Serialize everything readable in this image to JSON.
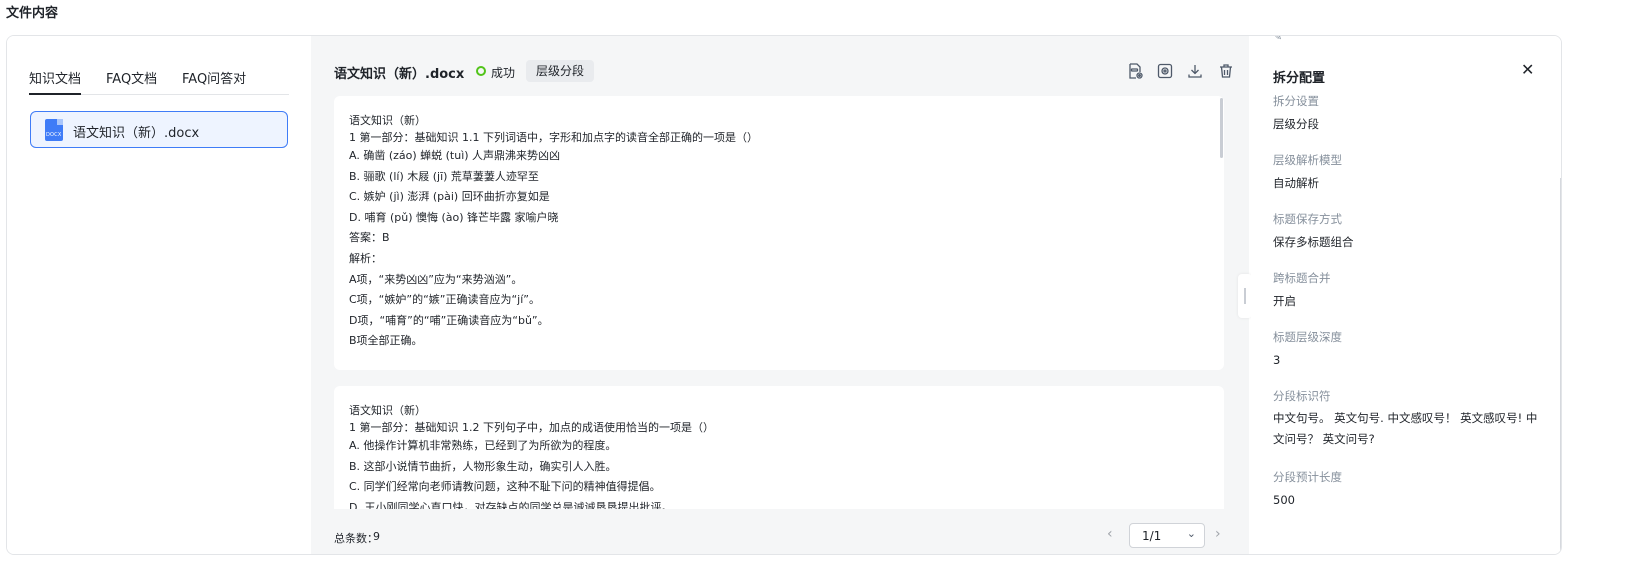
{
  "page": {
    "title": "文件内容"
  },
  "left": {
    "tabs": [
      {
        "label": "知识文档",
        "active": true
      },
      {
        "label": "FAQ文档",
        "active": false
      },
      {
        "label": "FAQ问答对",
        "active": false
      }
    ],
    "files": [
      {
        "name": "语文知识（新）.docx",
        "icon": "docx-file-icon",
        "icon_text": "DOCX",
        "selected": true
      }
    ]
  },
  "document": {
    "title": "语文知识（新）.docx",
    "status": "成功",
    "status_color": "#52c41a",
    "mode_badge": "层级分段",
    "toolbar_icons": [
      "document-settings-icon",
      "preview-icon",
      "download-icon",
      "delete-icon"
    ],
    "chunks": [
      {
        "lines": [
          "语文知识（新）",
          "1 第一部分：基础知识 1.1 下列词语中，字形和加点字的读音全部正确的一项是（）",
          "A. 确凿 (záo) 蝉蜕 (tuì) 人声鼎沸来势凶凶",
          "B. 骊歌 (lí) 木屐 (jī) 荒草萋萋人迹罕至",
          "C. 嫉妒 (jì) 澎湃 (pài) 回环曲折亦复如是",
          "D. 哺育 (pǔ) 懊悔 (ào) 锋芒毕露 家喻户晓",
          "答案：B",
          "解析：",
          "A项，“来势凶凶”应为“来势汹汹”。",
          "C项，“嫉妒”的“嫉”正确读音应为“jí”。",
          "D项，“哺育”的“哺”正确读音应为“bǔ”。",
          "B项全部正确。"
        ]
      },
      {
        "lines": [
          "语文知识（新）",
          "1 第一部分：基础知识 1.2 下列句子中，加点的成语使用恰当的一项是（）",
          "A. 他操作计算机非常熟练，已经到了为所欲为的程度。",
          "B. 这部小说情节曲折，人物形象生动，确实引人入胜。",
          "C. 同学们经常向老师请教问题，这种不耻下问的精神值得提倡。",
          "D. 王小刚同学心直口快，对存缺点的同学总是诚诚恳恳提出批评。"
        ]
      }
    ],
    "footer": {
      "total_label": "总条数：",
      "total_value": "9",
      "page_value": "1/1"
    }
  },
  "config": {
    "title": "拆分配置",
    "items": [
      {
        "label": "拆分设置",
        "value": "层级分段"
      },
      {
        "label": "层级解析模型",
        "value": "自动解析"
      },
      {
        "label": "标题保存方式",
        "value": "保存多标题组合"
      },
      {
        "label": "跨标题合并",
        "value": "开启"
      },
      {
        "label": "标题层级深度",
        "value": "3"
      },
      {
        "label": "分段标识符",
        "value": "中文句号。 英文句号. 中文感叹号！ 英文感叹号! 中文问号？ 英文问号?"
      },
      {
        "label": "分段预计长度",
        "value": "500"
      }
    ]
  }
}
